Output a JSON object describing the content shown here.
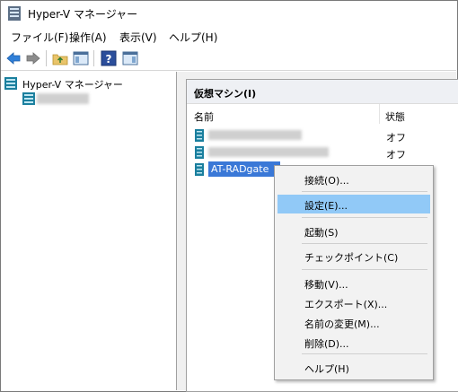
{
  "window": {
    "title": "Hyper-V マネージャー"
  },
  "menubar": {
    "items": [
      "ファイル(F)",
      "操作(A)",
      "表示(V)",
      "ヘルプ(H)"
    ]
  },
  "toolbar": {
    "icons": [
      "back-arrow-icon",
      "forward-arrow-icon",
      "folder-up-icon",
      "show-hide-console-tree-icon",
      "help-icon",
      "action-pane-icon"
    ]
  },
  "tree": {
    "root_label": "Hyper-V マネージャー"
  },
  "vm_panel": {
    "title": "仮想マシン(I)",
    "columns": {
      "name": "名前",
      "state": "状態"
    },
    "rows": [
      {
        "name": "",
        "state": "オフ",
        "selected": false
      },
      {
        "name": "",
        "state": "オフ",
        "selected": false
      },
      {
        "name": "AT-RADgate",
        "state": "",
        "selected": true
      }
    ]
  },
  "context_menu": {
    "items": [
      "接続(O)...",
      "設定(E)...",
      "起動(S)",
      "チェックポイント(C)",
      "移動(V)...",
      "エクスポート(X)...",
      "名前の変更(M)...",
      "削除(D)...",
      "ヘルプ(H)"
    ],
    "highlighted": "設定(E)..."
  },
  "colors": {
    "selection": "#3a78d7",
    "menu_highlight": "#91c9f7",
    "panel_header": "#eef0f4"
  }
}
